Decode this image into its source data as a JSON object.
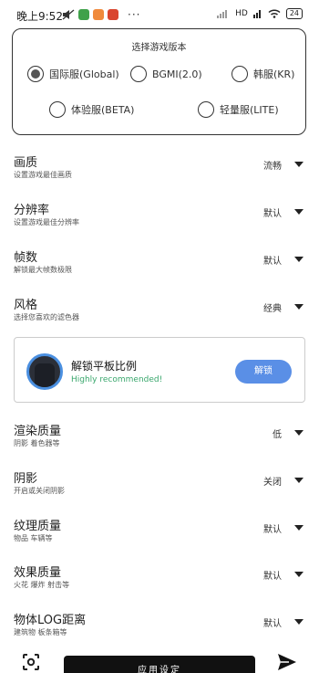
{
  "status_bar": {
    "time": "晚上9:52",
    "dots": "···",
    "network": "HD",
    "battery": "24",
    "colors": {
      "app1": "#e74c3c",
      "app2": "#3fa14a",
      "app3": "#f08a3c",
      "app4": "#d9442e"
    }
  },
  "version_panel": {
    "title": "选择游戏版本",
    "options": [
      {
        "label": "国际服(Global)",
        "selected": true
      },
      {
        "label": "BGMI(2.0)",
        "selected": false
      },
      {
        "label": "韩服(KR)",
        "selected": false
      },
      {
        "label": "体验服(BETA)",
        "selected": false
      },
      {
        "label": "轻量服(LITE)",
        "selected": false
      }
    ]
  },
  "settings": [
    {
      "title": "画质",
      "desc": "设置游戏最佳画质",
      "value": "流畅"
    },
    {
      "title": "分辨率",
      "desc": "设置游戏最佳分辨率",
      "value": "默认"
    },
    {
      "title": "帧数",
      "desc": "解锁最大帧数极限",
      "value": "默认"
    },
    {
      "title": "风格",
      "desc": "选择您喜欢的滤色器",
      "value": "经典"
    }
  ],
  "tablet_card": {
    "title": "解锁平板比例",
    "subtitle": "Highly recommended!",
    "button": "解锁",
    "accent": "#5a8fe6",
    "subtitle_color": "#3aa76d"
  },
  "settings2": [
    {
      "title": "渲染质量",
      "desc": "阴影 着色器等",
      "value": "低"
    },
    {
      "title": "阴影",
      "desc": "开启或关闭阴影",
      "value": "关闭"
    },
    {
      "title": "纹理质量",
      "desc": "物品 车辆等",
      "value": "默认"
    },
    {
      "title": "效果质量",
      "desc": "火花 爆炸 射击等",
      "value": "默认"
    },
    {
      "title": "物体LOG距离",
      "desc": "建筑物 板条箱等",
      "value": "默认"
    }
  ],
  "bottom_bar": {
    "apply_label": "应用设定"
  }
}
